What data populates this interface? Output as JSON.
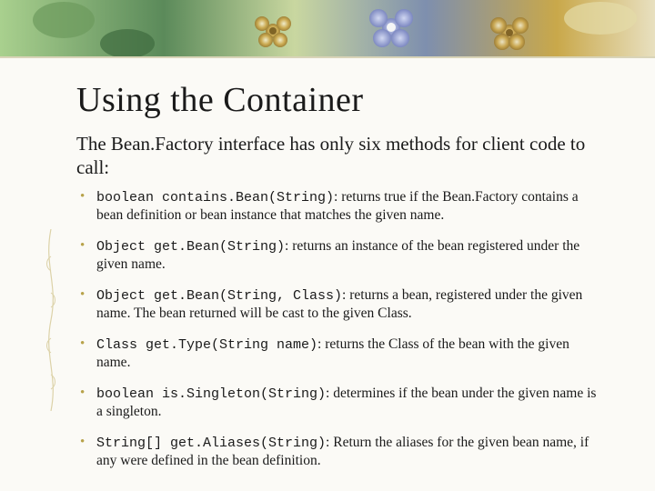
{
  "title": "Using the Container",
  "intro": "The Bean.Factory interface has only six methods for client code to call:",
  "methods": [
    {
      "sig": "boolean contains.Bean(String)",
      "desc": ": returns true if the Bean.Factory contains a bean definition or bean instance that matches the given name."
    },
    {
      "sig": "Object get.Bean(String)",
      "desc": ": returns an instance of the bean registered under the given name."
    },
    {
      "sig": "Object get.Bean(String, Class)",
      "desc": ": returns a bean, registered under the given name. The bean returned will be cast to the given Class."
    },
    {
      "sig": "Class get.Type(String name)",
      "desc": ": returns the Class of the bean with the given name."
    },
    {
      "sig": "boolean is.Singleton(String)",
      "desc": ": determines if the bean under the given name is a singleton."
    },
    {
      "sig": "String[] get.Aliases(String)",
      "desc": ": Return the aliases for the given bean name, if any were defined in the bean definition."
    }
  ]
}
